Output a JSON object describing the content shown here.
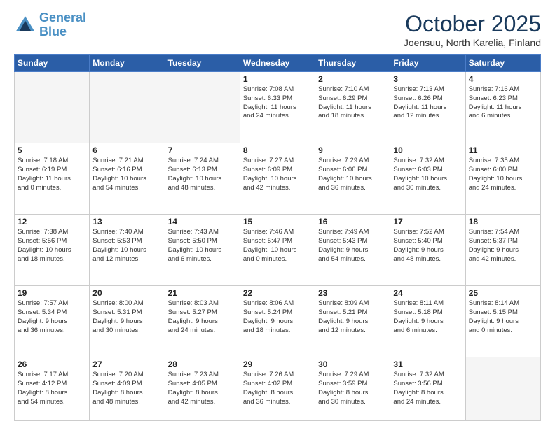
{
  "header": {
    "logo_line1": "General",
    "logo_line2": "Blue",
    "month": "October 2025",
    "location": "Joensuu, North Karelia, Finland"
  },
  "weekdays": [
    "Sunday",
    "Monday",
    "Tuesday",
    "Wednesday",
    "Thursday",
    "Friday",
    "Saturday"
  ],
  "weeks": [
    [
      {
        "day": "",
        "text": ""
      },
      {
        "day": "",
        "text": ""
      },
      {
        "day": "",
        "text": ""
      },
      {
        "day": "1",
        "text": "Sunrise: 7:08 AM\nSunset: 6:33 PM\nDaylight: 11 hours\nand 24 minutes."
      },
      {
        "day": "2",
        "text": "Sunrise: 7:10 AM\nSunset: 6:29 PM\nDaylight: 11 hours\nand 18 minutes."
      },
      {
        "day": "3",
        "text": "Sunrise: 7:13 AM\nSunset: 6:26 PM\nDaylight: 11 hours\nand 12 minutes."
      },
      {
        "day": "4",
        "text": "Sunrise: 7:16 AM\nSunset: 6:23 PM\nDaylight: 11 hours\nand 6 minutes."
      }
    ],
    [
      {
        "day": "5",
        "text": "Sunrise: 7:18 AM\nSunset: 6:19 PM\nDaylight: 11 hours\nand 0 minutes."
      },
      {
        "day": "6",
        "text": "Sunrise: 7:21 AM\nSunset: 6:16 PM\nDaylight: 10 hours\nand 54 minutes."
      },
      {
        "day": "7",
        "text": "Sunrise: 7:24 AM\nSunset: 6:13 PM\nDaylight: 10 hours\nand 48 minutes."
      },
      {
        "day": "8",
        "text": "Sunrise: 7:27 AM\nSunset: 6:09 PM\nDaylight: 10 hours\nand 42 minutes."
      },
      {
        "day": "9",
        "text": "Sunrise: 7:29 AM\nSunset: 6:06 PM\nDaylight: 10 hours\nand 36 minutes."
      },
      {
        "day": "10",
        "text": "Sunrise: 7:32 AM\nSunset: 6:03 PM\nDaylight: 10 hours\nand 30 minutes."
      },
      {
        "day": "11",
        "text": "Sunrise: 7:35 AM\nSunset: 6:00 PM\nDaylight: 10 hours\nand 24 minutes."
      }
    ],
    [
      {
        "day": "12",
        "text": "Sunrise: 7:38 AM\nSunset: 5:56 PM\nDaylight: 10 hours\nand 18 minutes."
      },
      {
        "day": "13",
        "text": "Sunrise: 7:40 AM\nSunset: 5:53 PM\nDaylight: 10 hours\nand 12 minutes."
      },
      {
        "day": "14",
        "text": "Sunrise: 7:43 AM\nSunset: 5:50 PM\nDaylight: 10 hours\nand 6 minutes."
      },
      {
        "day": "15",
        "text": "Sunrise: 7:46 AM\nSunset: 5:47 PM\nDaylight: 10 hours\nand 0 minutes."
      },
      {
        "day": "16",
        "text": "Sunrise: 7:49 AM\nSunset: 5:43 PM\nDaylight: 9 hours\nand 54 minutes."
      },
      {
        "day": "17",
        "text": "Sunrise: 7:52 AM\nSunset: 5:40 PM\nDaylight: 9 hours\nand 48 minutes."
      },
      {
        "day": "18",
        "text": "Sunrise: 7:54 AM\nSunset: 5:37 PM\nDaylight: 9 hours\nand 42 minutes."
      }
    ],
    [
      {
        "day": "19",
        "text": "Sunrise: 7:57 AM\nSunset: 5:34 PM\nDaylight: 9 hours\nand 36 minutes."
      },
      {
        "day": "20",
        "text": "Sunrise: 8:00 AM\nSunset: 5:31 PM\nDaylight: 9 hours\nand 30 minutes."
      },
      {
        "day": "21",
        "text": "Sunrise: 8:03 AM\nSunset: 5:27 PM\nDaylight: 9 hours\nand 24 minutes."
      },
      {
        "day": "22",
        "text": "Sunrise: 8:06 AM\nSunset: 5:24 PM\nDaylight: 9 hours\nand 18 minutes."
      },
      {
        "day": "23",
        "text": "Sunrise: 8:09 AM\nSunset: 5:21 PM\nDaylight: 9 hours\nand 12 minutes."
      },
      {
        "day": "24",
        "text": "Sunrise: 8:11 AM\nSunset: 5:18 PM\nDaylight: 9 hours\nand 6 minutes."
      },
      {
        "day": "25",
        "text": "Sunrise: 8:14 AM\nSunset: 5:15 PM\nDaylight: 9 hours\nand 0 minutes."
      }
    ],
    [
      {
        "day": "26",
        "text": "Sunrise: 7:17 AM\nSunset: 4:12 PM\nDaylight: 8 hours\nand 54 minutes."
      },
      {
        "day": "27",
        "text": "Sunrise: 7:20 AM\nSunset: 4:09 PM\nDaylight: 8 hours\nand 48 minutes."
      },
      {
        "day": "28",
        "text": "Sunrise: 7:23 AM\nSunset: 4:05 PM\nDaylight: 8 hours\nand 42 minutes."
      },
      {
        "day": "29",
        "text": "Sunrise: 7:26 AM\nSunset: 4:02 PM\nDaylight: 8 hours\nand 36 minutes."
      },
      {
        "day": "30",
        "text": "Sunrise: 7:29 AM\nSunset: 3:59 PM\nDaylight: 8 hours\nand 30 minutes."
      },
      {
        "day": "31",
        "text": "Sunrise: 7:32 AM\nSunset: 3:56 PM\nDaylight: 8 hours\nand 24 minutes."
      },
      {
        "day": "",
        "text": ""
      }
    ]
  ]
}
